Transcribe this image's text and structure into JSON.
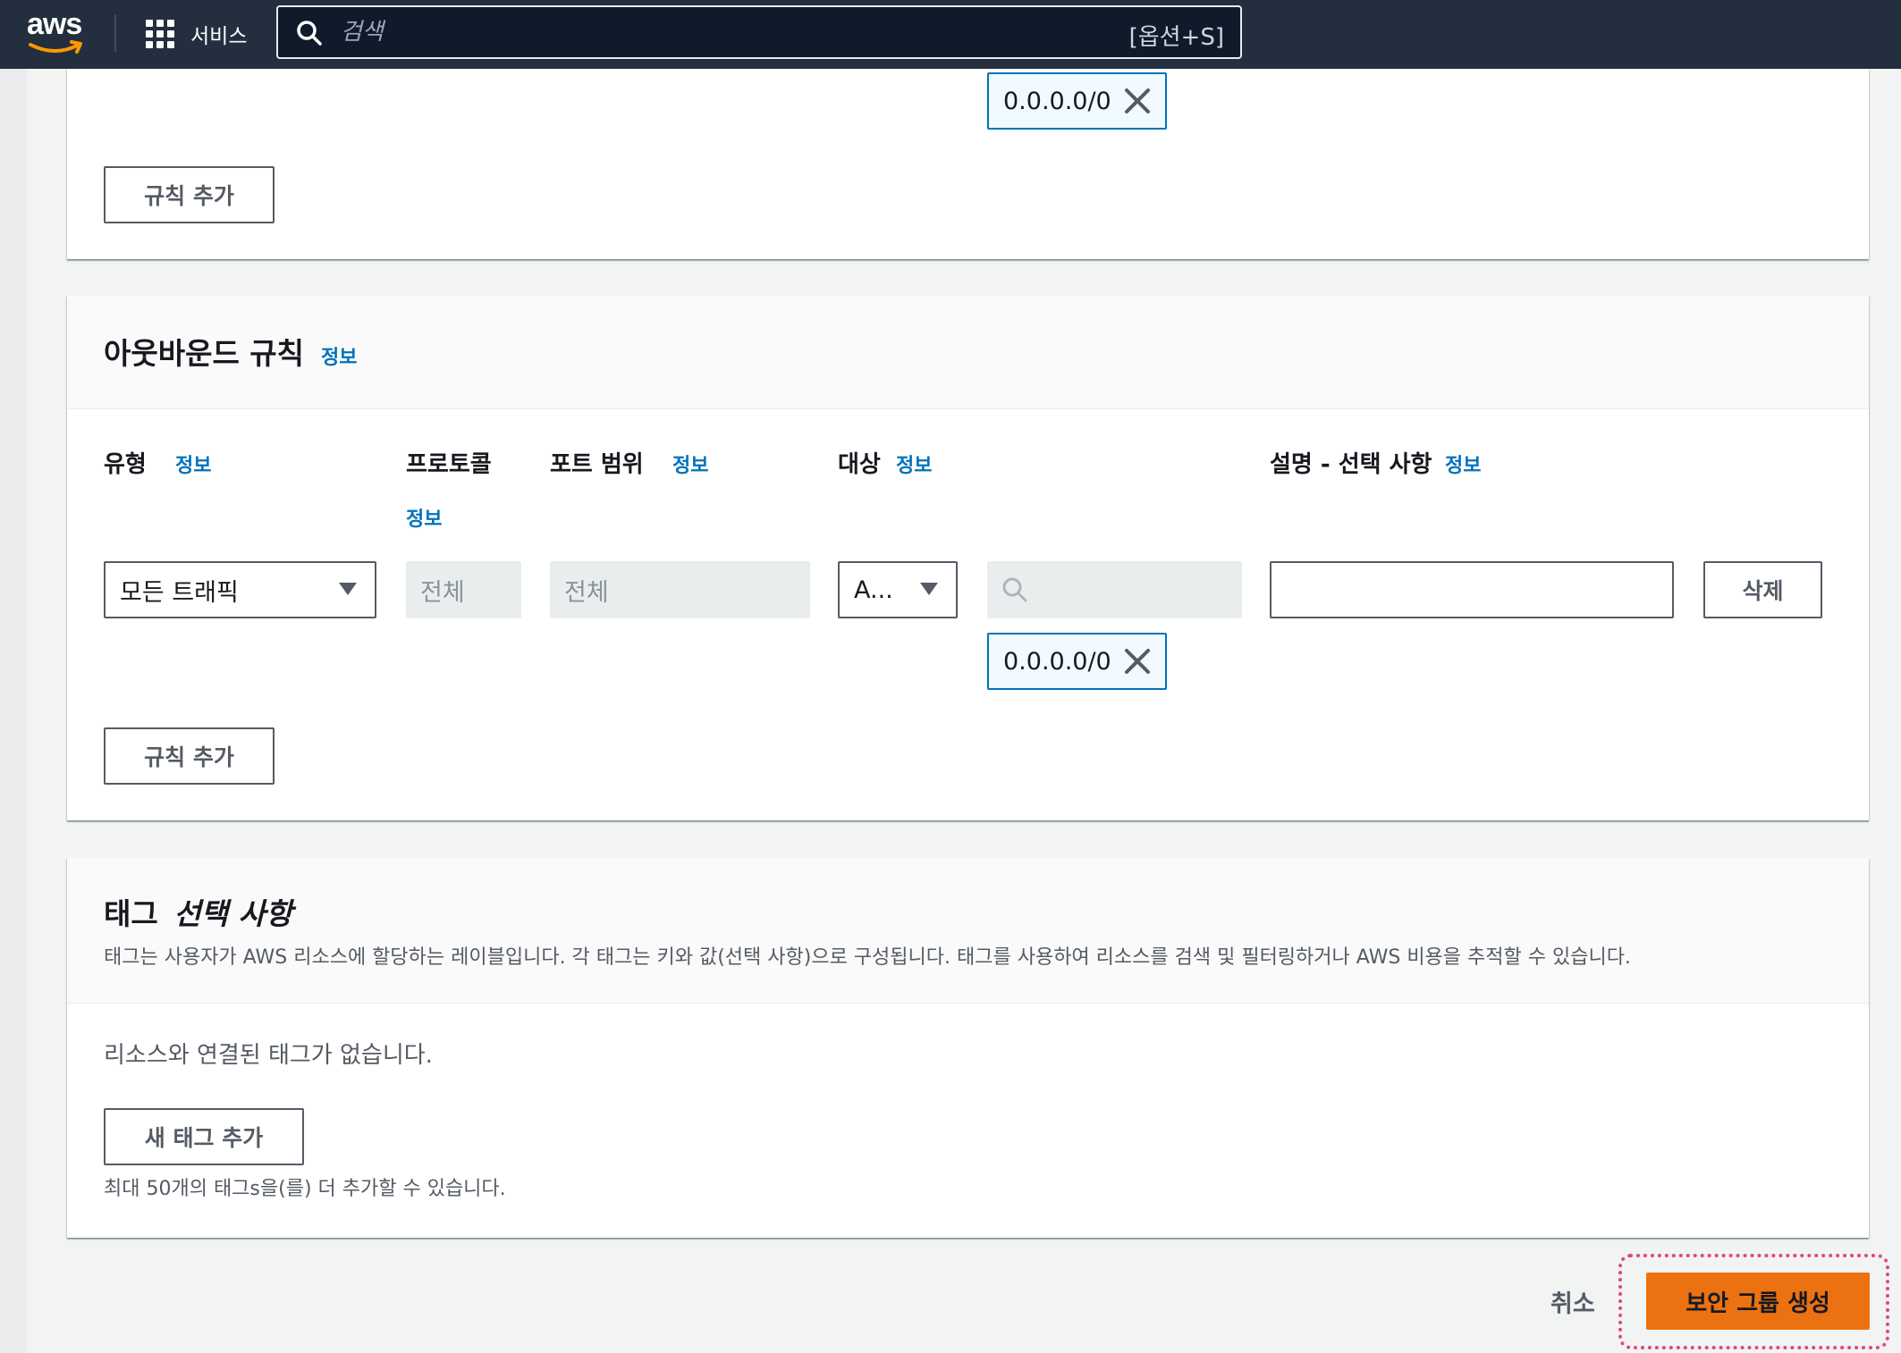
{
  "nav": {
    "logo": "aws",
    "services_label": "서비스",
    "search_placeholder": "검색",
    "search_shortcut": "[옵션+S]"
  },
  "inbound": {
    "token": "0.0.0.0/0",
    "add_rule": "규칙 추가"
  },
  "outbound": {
    "title": "아웃바운드 규칙",
    "info": "정보",
    "columns": {
      "type": "유형",
      "type_info": "정보",
      "protocol": "프로토콜",
      "protocol_info": "정보",
      "port_range": "포트 범위",
      "port_range_info": "정보",
      "destination": "대상",
      "destination_info": "정보",
      "description": "설명 - 선택 사항",
      "description_info": "정보"
    },
    "row": {
      "type_value": "모든 트래픽",
      "protocol_value": "전체",
      "port_value": "전체",
      "destination_select": "A...",
      "token": "0.0.0.0/0",
      "delete": "삭제"
    },
    "add_rule": "규칙 추가"
  },
  "tags": {
    "title": "태그",
    "title_optional": "선택 사항",
    "description": "태그는 사용자가 AWS 리소스에 할당하는 레이블입니다. 각 태그는 키와 값(선택 사항)으로 구성됩니다. 태그를 사용하여 리소스를 검색 및 필터링하거나 AWS 비용을 추적할 수 있습니다.",
    "empty": "리소스와 연결된 태그가 없습니다.",
    "add_tag": "새 태그 추가",
    "limit_note": "최대 50개의 태그s을(를) 더 추가할 수 있습니다."
  },
  "footer": {
    "cancel": "취소",
    "create": "보안 그룹 생성"
  },
  "colors": {
    "nav_bg": "#232f3e",
    "link": "#0073bb",
    "primary": "#ec7211",
    "highlight": "#e0448a"
  }
}
